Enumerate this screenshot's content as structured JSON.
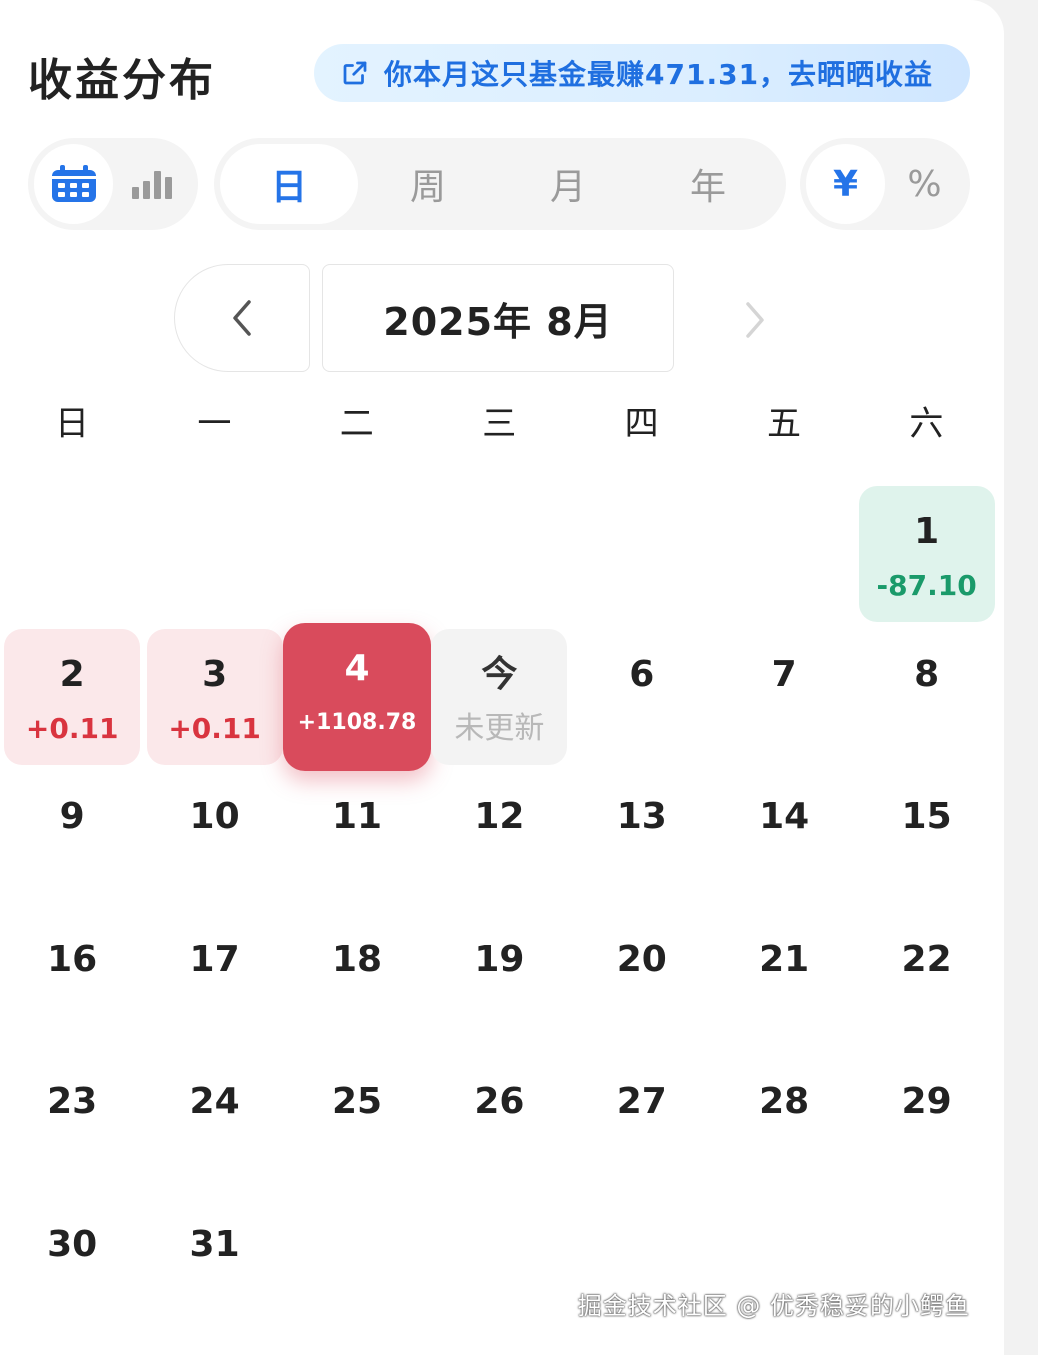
{
  "title": "收益分布",
  "share": {
    "text": "你本月这只基金最赚471.31，去晒晒收益",
    "icon": "external-link-icon"
  },
  "view_toggle": {
    "items": [
      {
        "icon": "calendar-icon",
        "active": true
      },
      {
        "icon": "bar-chart-icon",
        "active": false
      }
    ]
  },
  "period_tabs": [
    {
      "label": "日",
      "active": true
    },
    {
      "label": "周",
      "active": false
    },
    {
      "label": "月",
      "active": false
    },
    {
      "label": "年",
      "active": false
    }
  ],
  "unit_toggle": [
    {
      "label": "¥",
      "active": true
    },
    {
      "label": "%",
      "active": false
    }
  ],
  "month_label": "2025年 8月",
  "weekdays": [
    "日",
    "一",
    "二",
    "三",
    "四",
    "五",
    "六"
  ],
  "days": [
    {
      "num": "1",
      "val": "-87.10",
      "type": "loss"
    },
    {
      "num": "2",
      "val": "+0.11",
      "type": "gain"
    },
    {
      "num": "3",
      "val": "+0.11",
      "type": "gain"
    },
    {
      "num": "4",
      "val": "+1108.78",
      "type": "big"
    },
    {
      "num": "今",
      "val": "未更新",
      "type": "today"
    },
    {
      "num": "6"
    },
    {
      "num": "7"
    },
    {
      "num": "8"
    },
    {
      "num": "9"
    },
    {
      "num": "10"
    },
    {
      "num": "11"
    },
    {
      "num": "12"
    },
    {
      "num": "13"
    },
    {
      "num": "14"
    },
    {
      "num": "15"
    },
    {
      "num": "16"
    },
    {
      "num": "17"
    },
    {
      "num": "18"
    },
    {
      "num": "19"
    },
    {
      "num": "20"
    },
    {
      "num": "21"
    },
    {
      "num": "22"
    },
    {
      "num": "23"
    },
    {
      "num": "24"
    },
    {
      "num": "25"
    },
    {
      "num": "26"
    },
    {
      "num": "27"
    },
    {
      "num": "28"
    },
    {
      "num": "29"
    },
    {
      "num": "30"
    },
    {
      "num": "31"
    }
  ],
  "first_weekday_index": 5,
  "colors": {
    "accent": "#2574e8",
    "gain": "#d9343f",
    "loss": "#1a9a6a",
    "highlight": "#d94b5c"
  },
  "watermark": "掘金技术社区 @ 优秀稳妥的小鳄鱼"
}
